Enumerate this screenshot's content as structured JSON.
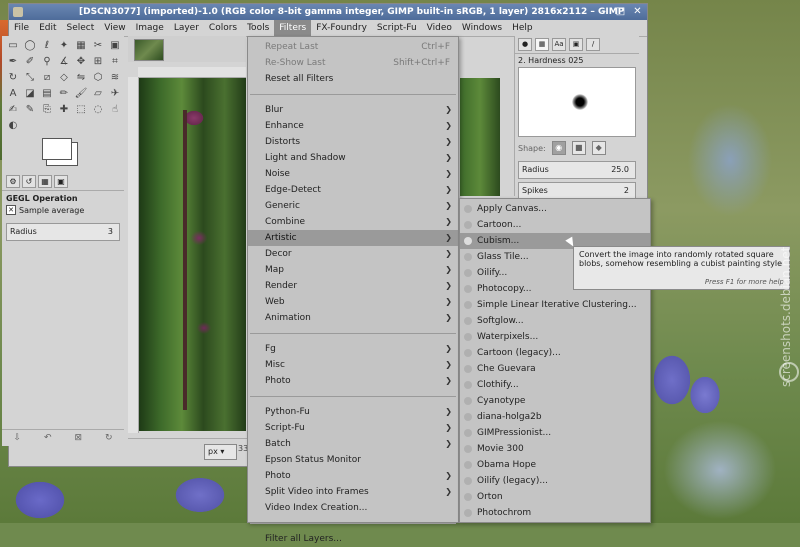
{
  "window": {
    "title": "[DSCN3077] (imported)-1.0 (RGB color 8-bit gamma integer, GIMP built-in sRGB, 1 layer) 2816x2112 – GIMP"
  },
  "menubar": [
    "File",
    "Edit",
    "Select",
    "View",
    "Image",
    "Layer",
    "Colors",
    "Tools",
    "Filters",
    "FX-Foundry",
    "Script-Fu",
    "Video",
    "Windows",
    "Help"
  ],
  "toolbox": {
    "panel_title": "GEGL Operation",
    "sample_average": "Sample average",
    "radius_label": "Radius",
    "radius_value": "3"
  },
  "status": {
    "unit": "px",
    "zoom": "33"
  },
  "brushes": {
    "name": "2. Hardness 025",
    "shape_label": "Shape:",
    "radius_label": "Radius",
    "radius_value": "25.0",
    "spikes_label": "Spikes",
    "spikes_value": "2"
  },
  "filters_menu": {
    "top": [
      {
        "label": "Repeat Last",
        "accel": "Ctrl+F"
      },
      {
        "label": "Re-Show Last",
        "accel": "Shift+Ctrl+F"
      },
      {
        "label": "Reset all Filters",
        "accel": ""
      }
    ],
    "group1": [
      "Blur",
      "Enhance",
      "Distorts",
      "Light and Shadow",
      "Noise",
      "Edge-Detect",
      "Generic",
      "Combine",
      "Artistic",
      "Decor",
      "Map",
      "Render",
      "Web",
      "Animation"
    ],
    "group2": [
      "Fg",
      "Misc",
      "Photo"
    ],
    "group3": [
      "Python-Fu",
      "Script-Fu",
      "Batch",
      "Epson Status Monitor",
      "Photo",
      "Split Video into Frames",
      "Video Index Creation..."
    ],
    "bottom": "Filter all Layers..."
  },
  "artistic_menu": [
    "Apply Canvas...",
    "Cartoon...",
    "Cubism...",
    "Glass Tile...",
    "Oilify...",
    "Photocopy...",
    "Simple Linear Iterative Clustering...",
    "Softglow...",
    "Waterpixels...",
    "Cartoon (legacy)...",
    "Che Guevara",
    "Clothify...",
    "Cyanotype",
    "diana-holga2b",
    "GIMPressionist...",
    "Movie 300",
    "Obama Hope",
    "Oilify (legacy)...",
    "Orton",
    "Photochrom"
  ],
  "tooltip": {
    "line1": "Convert the image into randomly rotated square",
    "line2": "blobs, somehow resembling a cubist painting style",
    "hint": "Press F1 for more help"
  },
  "watermark": "screenshots.debian.net"
}
